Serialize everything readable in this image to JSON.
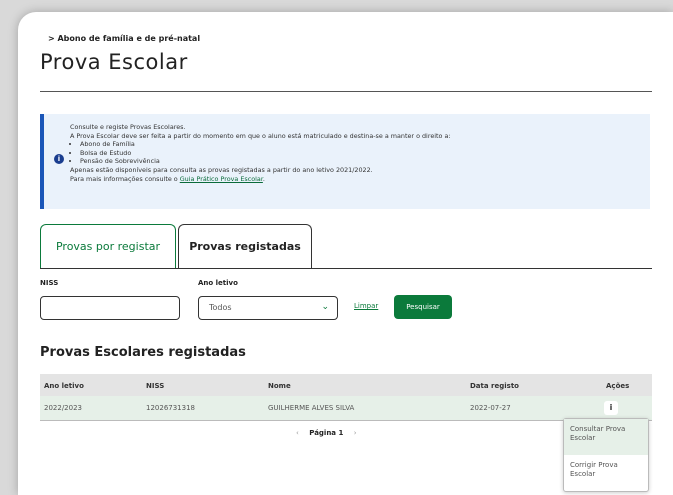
{
  "breadcrumb": "> Abono de família e de pré-natal",
  "title": "Prova Escolar",
  "info": {
    "line1": "Consulte e registe Provas Escolares.",
    "line2": "A Prova Escolar deve ser feita a partir do momento em que o aluno está matriculado e destina-se a manter o direito a:",
    "bullets": [
      "Abono de Família",
      "Bolsa de Estudo",
      "Pensão de Sobrevivência"
    ],
    "line3": "Apenas estão disponíveis para consulta as provas registadas a partir do ano letivo 2021/2022.",
    "line4_prefix": "Para mais informações consulte o ",
    "line4_link": "Guia Prático Prova Escolar",
    "line4_suffix": "."
  },
  "tabs": [
    {
      "label": "Provas por registar"
    },
    {
      "label": "Provas registadas"
    }
  ],
  "filters": {
    "niss_label": "NISS",
    "niss_value": "",
    "ano_label": "Ano letivo",
    "ano_value": "Todos",
    "limpar": "Limpar",
    "pesquisar": "Pesquisar"
  },
  "section_title": "Provas Escolares registadas",
  "table": {
    "headers": [
      "Ano letivo",
      "NISS",
      "Nome",
      "Data registo",
      "Ações"
    ],
    "rows": [
      {
        "ano": "2022/2023",
        "niss": "12026731318",
        "nome": "GUILHERME ALVES SILVA",
        "data": "2022-07-27",
        "acoes": "i"
      }
    ]
  },
  "pager": {
    "label": "Página 1"
  },
  "menu": [
    "Consultar Prova Escolar",
    "Corrigir Prova Escolar"
  ]
}
